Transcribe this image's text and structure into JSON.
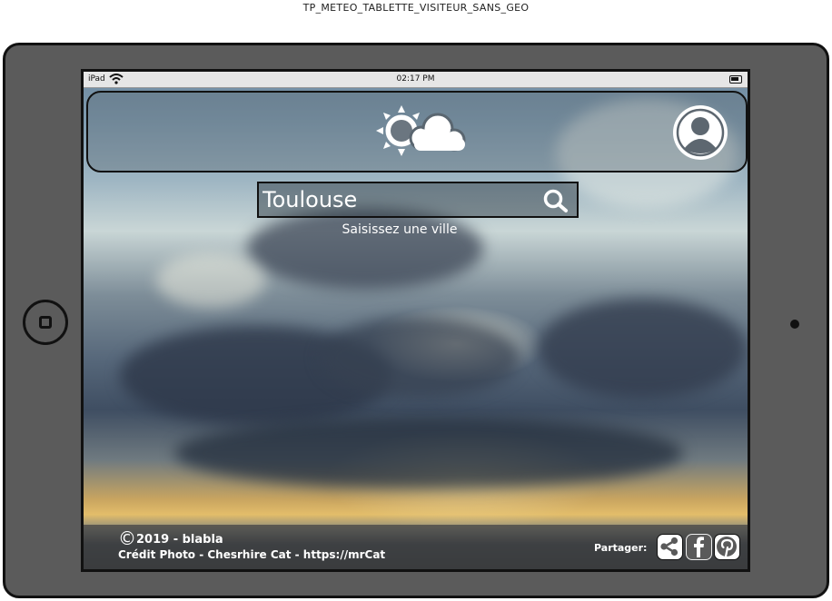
{
  "caption": "TP_METEO_TABLETTE_VISITEUR_SANS_GEO",
  "status_bar": {
    "carrier": "iPad",
    "time": "02:17 PM"
  },
  "header": {
    "logo_icon": "sun-cloud-icon",
    "avatar_icon": "user-avatar-icon"
  },
  "search": {
    "value": "Toulouse",
    "hint": "Saisissez une ville",
    "icon": "search-icon"
  },
  "footer": {
    "copyright": "2019 - blabla",
    "credit": "Crédit Photo - Chesrhire Cat - https://mrCat",
    "share_label": "Partager:",
    "social": [
      "share-icon",
      "facebook-icon",
      "pinterest-icon"
    ]
  },
  "colors": {
    "frame": "#5b5b5b",
    "outline": "#111111",
    "text": "#ffffff"
  }
}
